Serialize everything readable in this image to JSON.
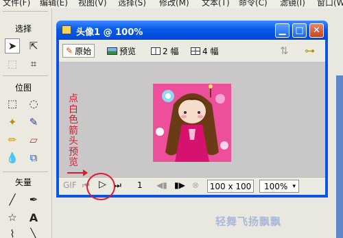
{
  "menu": {
    "items": [
      "文件(F)",
      "编辑(E)",
      "视图(V)",
      "选择(S)",
      "修改(M)",
      "文本(T)",
      "命令(C)",
      "滤镜(I)",
      "窗口(W)"
    ]
  },
  "tools": {
    "select_label": "选择",
    "bitmap_label": "位图",
    "vector_label": "矢量",
    "text_tool_glyph": "A"
  },
  "window": {
    "title": "头像1 @ 100%",
    "minimize": "▁",
    "maximize": "□",
    "close": "✕"
  },
  "tabs": [
    {
      "label": "原始",
      "icon": "pencil-icon"
    },
    {
      "label": "预览",
      "icon": "landscape-icon"
    },
    {
      "label": "2 幅",
      "icon": "two-pane-icon"
    },
    {
      "label": "4 幅",
      "icon": "four-pane-icon"
    }
  ],
  "status": {
    "gif": "GIF",
    "frame": "1",
    "size": "100 x 100",
    "zoom": "100%"
  },
  "annotation": {
    "text": "点白色箭头预览"
  },
  "watermark": "轻舞飞扬飘飘"
}
